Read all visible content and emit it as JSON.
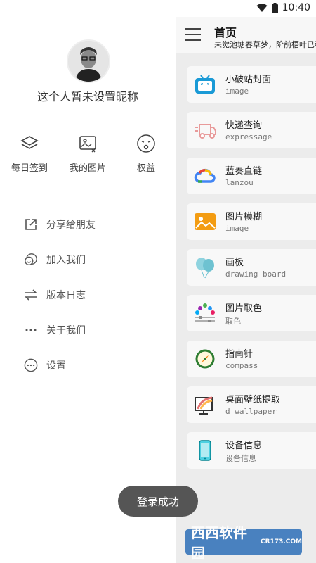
{
  "status_bar": {
    "time": "10:40"
  },
  "drawer": {
    "nickname": "这个人暂未设置昵称",
    "quick_actions": [
      {
        "label": "每日签到",
        "icon": "layers-icon"
      },
      {
        "label": "我的图片",
        "icon": "image-icon"
      },
      {
        "label": "权益",
        "icon": "face-icon"
      }
    ],
    "menu": [
      {
        "label": "分享给朋友",
        "icon": "share-icon"
      },
      {
        "label": "加入我们",
        "icon": "group-icon"
      },
      {
        "label": "版本日志",
        "icon": "swap-icon"
      },
      {
        "label": "关于我们",
        "icon": "dots-icon"
      },
      {
        "label": "设置",
        "icon": "settings-icon"
      }
    ]
  },
  "main": {
    "title": "首页",
    "subtitle": "未觉池塘春草梦，阶前梧叶已秋",
    "cards": [
      {
        "title": "小破站封面",
        "sub": "image",
        "icon": "bilibili-tv-icon"
      },
      {
        "title": "快递查询",
        "sub": "expressage",
        "icon": "truck-icon"
      },
      {
        "title": "蓝奏直链",
        "sub": "lanzou",
        "icon": "cloud-icon"
      },
      {
        "title": "图片模糊",
        "sub": "image",
        "icon": "picture-icon"
      },
      {
        "title": "画板",
        "sub": "drawing board",
        "icon": "balloons-icon"
      },
      {
        "title": "图片取色",
        "sub": "取色",
        "icon": "palette-icon"
      },
      {
        "title": "指南针",
        "sub": "compass",
        "icon": "compass-icon"
      },
      {
        "title": "桌面壁纸提取",
        "sub": "d wallpaper",
        "icon": "monitor-icon"
      },
      {
        "title": "设备信息",
        "sub": "设备信息",
        "icon": "phone-icon"
      }
    ]
  },
  "toast": "登录成功",
  "watermark": {
    "text": "西西软件园",
    "sub": "CR173.COM"
  }
}
